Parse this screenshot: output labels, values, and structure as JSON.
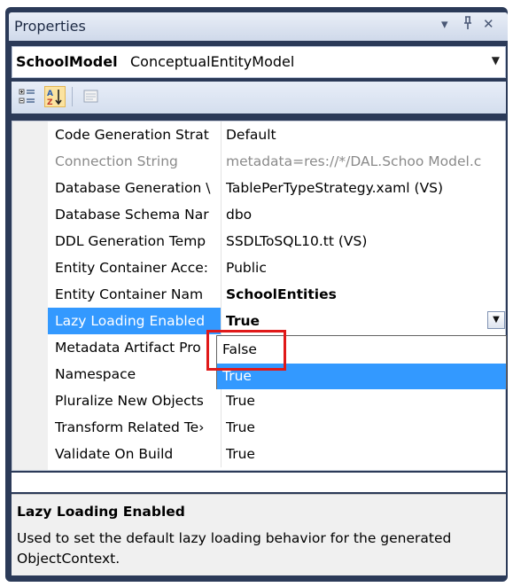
{
  "window": {
    "title": "Properties",
    "controls": {
      "dropdown": "▾",
      "pin": "⊥",
      "close": "✕"
    }
  },
  "object_selector": {
    "name": "SchoolModel",
    "type": "ConceptualEntityModel"
  },
  "toolbar": {
    "buttons": [
      "categorized-icon",
      "alphabetical-icon",
      "property-pages-icon"
    ]
  },
  "properties": [
    {
      "name": "Code Generation Strat",
      "value": "Default"
    },
    {
      "name": "Connection String",
      "value": "metadata=res://*/DAL.Schoo Model.c"
    },
    {
      "name": "Database Generation \\",
      "value": "TablePerTypeStrategy.xaml (VS)"
    },
    {
      "name": "Database Schema Nar",
      "value": "dbo"
    },
    {
      "name": "DDL Generation Temp",
      "value": "SSDLToSQL10.tt (VS)"
    },
    {
      "name": "Entity Container Acce:",
      "value": "Public"
    },
    {
      "name": "Entity Container Nam",
      "value": "SchoolEntities"
    },
    {
      "name": "Lazy Loading Enabled",
      "value": "True"
    },
    {
      "name": "Metadata Artifact Pro",
      "value": ""
    },
    {
      "name": "Namespace",
      "value": ""
    },
    {
      "name": "Pluralize New Objects",
      "value": "True"
    },
    {
      "name": "Transform Related Te›",
      "value": "True"
    },
    {
      "name": "Validate On Build",
      "value": "True"
    }
  ],
  "dropdown": {
    "options": [
      "False",
      "True"
    ],
    "selected": "True"
  },
  "description": {
    "title": "Lazy Loading Enabled",
    "text": "Used to set the default lazy loading behavior for the generated ObjectContext."
  },
  "colors": {
    "selection": "#3399ff",
    "highlight_box": "#e01919",
    "frame": "#2b3a58"
  }
}
